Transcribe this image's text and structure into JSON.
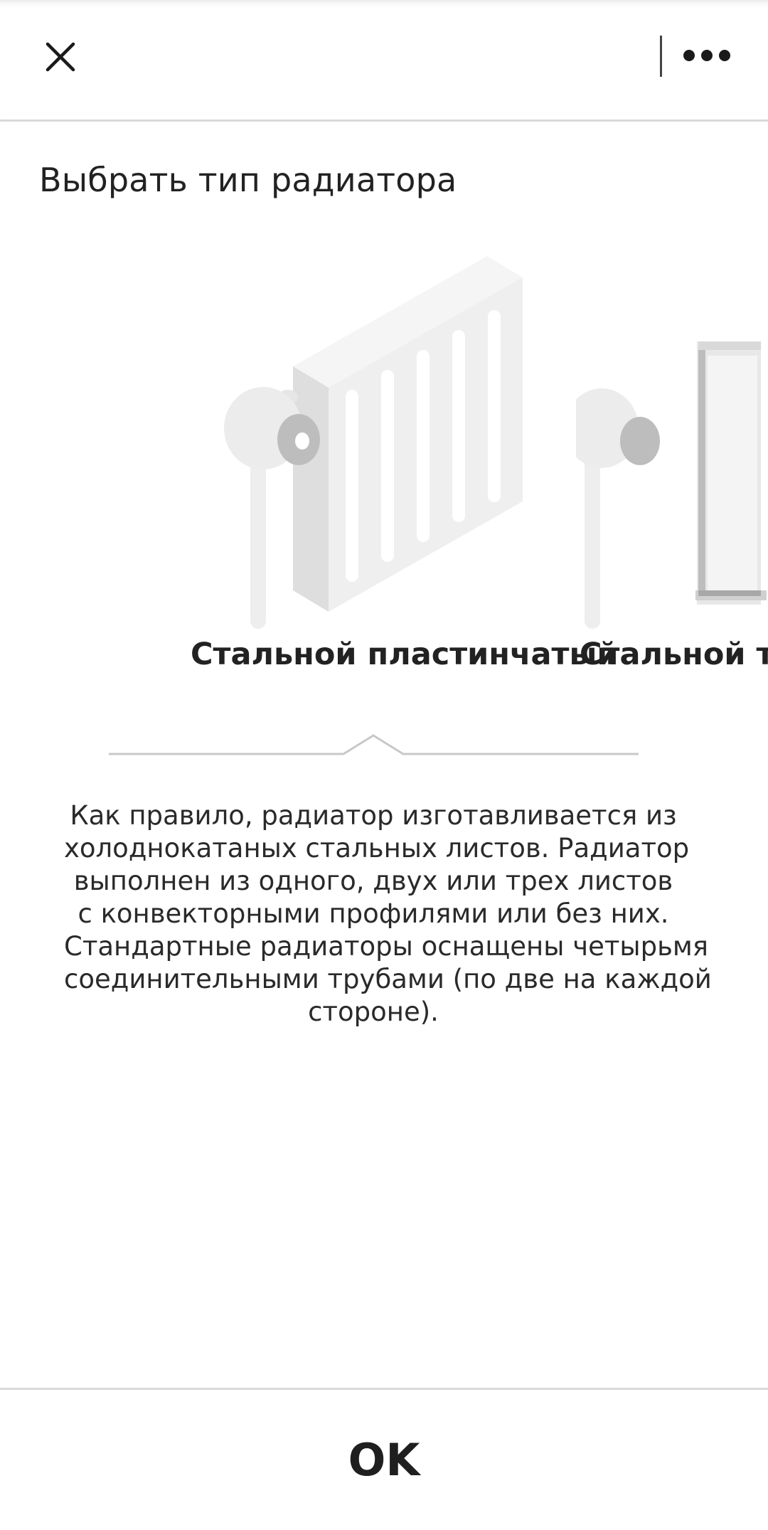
{
  "header": {
    "close_icon": "close-icon",
    "more_icon": "more-dots-icon"
  },
  "page": {
    "title": "Выбрать тип радиатора"
  },
  "carousel": {
    "items": [
      {
        "label": "Стальной пластинчатый",
        "icon": "panel-radiator-icon",
        "selected": true
      },
      {
        "label": "Стальной т",
        "icon": "tubular-radiator-icon",
        "selected": false
      }
    ]
  },
  "description": {
    "lines": [
      "Как правило, радиатор изготавливается из",
      "холоднокатаных стальных листов. Радиатор",
      "выполнен из одного, двух или трех листов",
      "с конвекторными профилями или без них.",
      "Стандартные радиаторы оснащены четырьмя",
      "соединительными трубами (по две на каждой",
      "стороне)."
    ]
  },
  "footer": {
    "ok_label": "OK"
  },
  "colors": {
    "text": "#222222",
    "divider": "#d9d9d9",
    "illustration_light": "#f2f2f2",
    "illustration_mid": "#e3e3e3",
    "illustration_dark": "#a8a8a8"
  }
}
